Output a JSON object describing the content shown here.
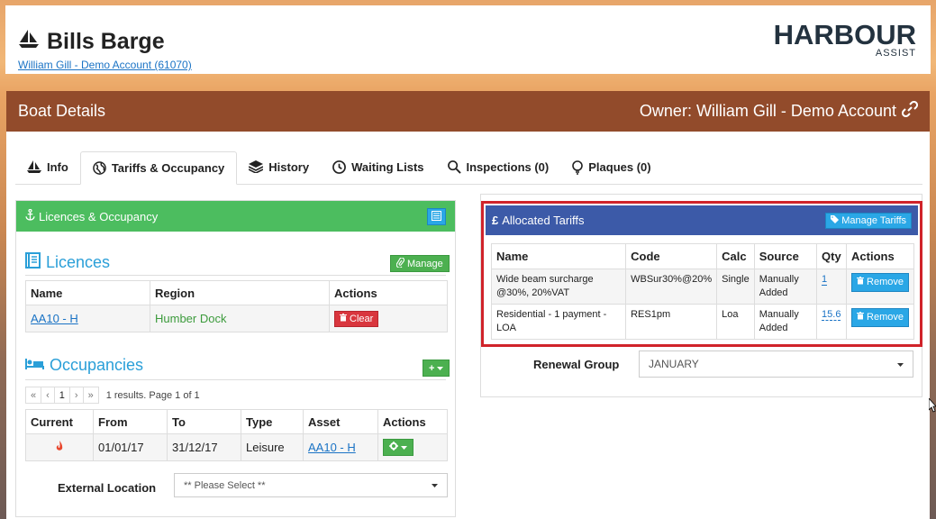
{
  "header": {
    "title": "Bills Barge",
    "account_link": "William Gill - Demo Account (61070)",
    "logo_main": "HARBOUR",
    "logo_sub": "ASSIST"
  },
  "boat_panel": {
    "title": "Boat Details",
    "owner": "Owner: William Gill - Demo Account"
  },
  "tabs": [
    {
      "label": "Info"
    },
    {
      "label": "Tariffs & Occupancy"
    },
    {
      "label": "History"
    },
    {
      "label": "Waiting Lists"
    },
    {
      "label": "Inspections (0)"
    },
    {
      "label": "Plaques (0)"
    }
  ],
  "licences_card": {
    "title": "Licences & Occupancy",
    "licences_heading": "Licences",
    "manage_label": "Manage",
    "columns": [
      "Name",
      "Region",
      "Actions"
    ],
    "rows": [
      {
        "name": "AA10 - H",
        "region": "Humber Dock",
        "action": "Clear"
      }
    ],
    "occupancies_heading": "Occupancies",
    "add_label": "+",
    "pager": {
      "first": "«",
      "prev": "‹",
      "page": "1",
      "next": "›",
      "last": "»",
      "info": "1 results. Page 1 of 1"
    },
    "occ_columns": [
      "Current",
      "From",
      "To",
      "Type",
      "Asset",
      "Actions"
    ],
    "occ_rows": [
      {
        "from": "01/01/17",
        "to": "31/12/17",
        "type": "Leisure",
        "asset": "AA10 - H"
      }
    ],
    "external_location_label": "External Location",
    "external_location_value": "** Please Select **"
  },
  "tariffs_card": {
    "title": "Allocated Tariffs",
    "manage_label": "Manage Tariffs",
    "columns": [
      "Name",
      "Code",
      "Calc",
      "Source",
      "Qty",
      "Actions"
    ],
    "rows": [
      {
        "name": "Wide beam surcharge @30%, 20%VAT",
        "code": "WBSur30%@20%",
        "calc": "Single",
        "source": "Manually Added",
        "qty": "1",
        "action": "Remove"
      },
      {
        "name": "Residential - 1 payment - LOA",
        "code": "RES1pm",
        "calc": "Loa",
        "source": "Manually Added",
        "qty": "15.6",
        "action": "Remove"
      }
    ],
    "renewal_label": "Renewal Group",
    "renewal_value": "JANUARY"
  },
  "colors": {
    "brown": "#924b2b",
    "green": "#4cbd5f",
    "blue_header": "#3c5aa8",
    "accent_blue": "#2aa7e6",
    "red": "#d9363e",
    "highlight_red": "#d0232a"
  }
}
